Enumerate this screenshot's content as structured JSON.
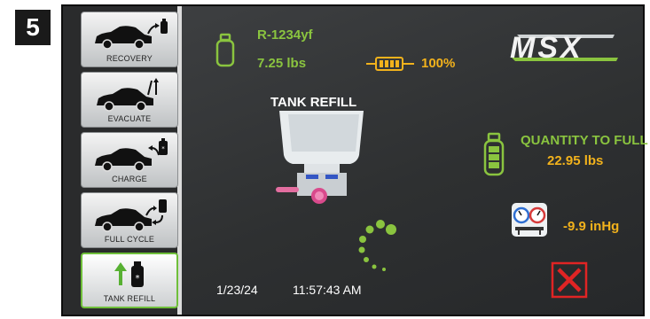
{
  "step_number": "5",
  "sidebar": {
    "items": [
      {
        "label": "RECOVERY",
        "icon": "car-recovery-icon"
      },
      {
        "label": "EVACUATE",
        "icon": "car-evacuate-icon"
      },
      {
        "label": "CHARGE",
        "icon": "car-charge-icon"
      },
      {
        "label": "FULL CYCLE",
        "icon": "car-full-cycle-icon"
      },
      {
        "label": "TANK REFILL",
        "icon": "tank-refill-icon",
        "active": true
      }
    ]
  },
  "header": {
    "refrigerant": "R-1234yf",
    "tank_weight": "7.25 lbs",
    "battery_level": "100%",
    "logo_text": "MSX"
  },
  "main": {
    "mode_title": "TANK REFILL",
    "quantity_label": "QUANTITY TO FULL",
    "quantity_value": "22.95 lbs",
    "pressure_value": "-9.9 inHg",
    "date": "1/23/24",
    "time": "11:57:43 AM"
  },
  "colors": {
    "green": "#8ac43f",
    "yellow": "#f2b21c",
    "stop_red": "#e02424",
    "screen_bg": "#2e3031"
  }
}
